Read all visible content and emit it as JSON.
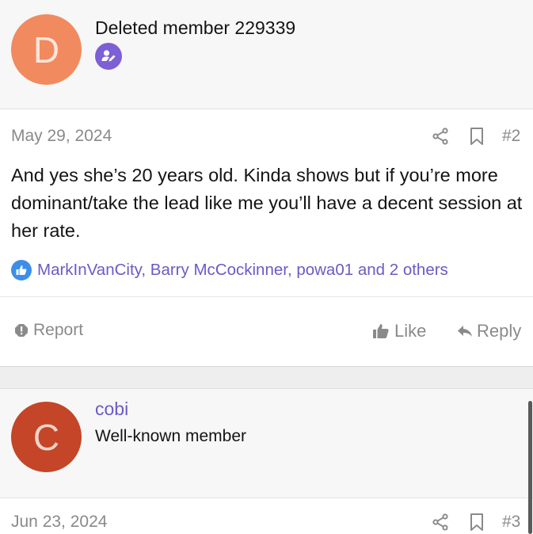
{
  "posts": [
    {
      "avatar_letter": "D",
      "username": "Deleted member 229339",
      "badge_icon": "user-edit-icon",
      "date": "May 29, 2024",
      "post_number": "#2",
      "message": "And yes she’s 20 years old. Kinda shows but if you’re more dominant/take the lead like me you’ll have a decent session at her rate.",
      "reactions": "MarkInVanCity, Barry McCockinner, powa01 and 2 others",
      "actions": {
        "report": "Report",
        "like": "Like",
        "reply": "Reply"
      }
    },
    {
      "avatar_letter": "C",
      "username": "cobi",
      "user_title": "Well-known member",
      "date": "Jun 23, 2024",
      "post_number": "#3"
    }
  ],
  "colors": {
    "avatar_d": "#f28a5f",
    "avatar_c": "#c44527",
    "link": "#6b5bc4",
    "badge": "#7d5fd6",
    "like_reaction": "#3d8ee8",
    "muted": "#8a8a8a"
  }
}
